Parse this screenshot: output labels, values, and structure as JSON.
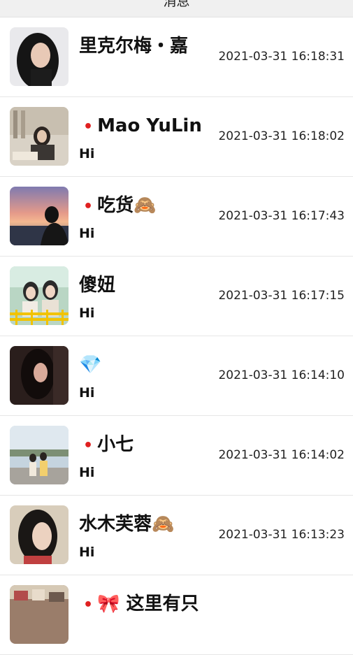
{
  "header": {
    "title": "消息"
  },
  "conversations": [
    {
      "name": "里克尔梅・嘉",
      "unread": false,
      "preview": "",
      "time": "2021-03-31 16:18:31"
    },
    {
      "name": "Mao YuLin",
      "unread": true,
      "preview": "Hi",
      "time": "2021-03-31 16:18:02"
    },
    {
      "name": "吃货🙈",
      "unread": true,
      "preview": "Hi",
      "time": "2021-03-31 16:17:43"
    },
    {
      "name": "傻妞",
      "unread": false,
      "preview": "Hi",
      "time": "2021-03-31 16:17:15"
    },
    {
      "name": "💎",
      "unread": false,
      "preview": "Hi",
      "time": "2021-03-31 16:14:10"
    },
    {
      "name": "小七",
      "unread": true,
      "preview": "Hi",
      "time": "2021-03-31 16:14:02"
    },
    {
      "name": "水木芙蓉🙈",
      "unread": false,
      "preview": "Hi",
      "time": "2021-03-31 16:13:23"
    },
    {
      "name": "🎀 这里有只",
      "unread": true,
      "preview": "",
      "time": ""
    }
  ],
  "unread_dot": "•"
}
